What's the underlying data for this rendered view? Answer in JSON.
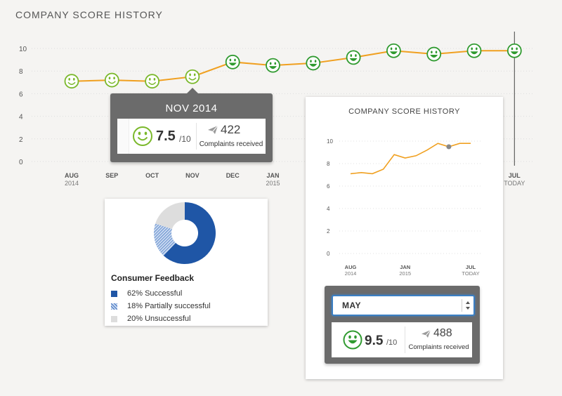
{
  "header": {
    "title": "COMPANY SCORE HISTORY"
  },
  "chart_data": [
    {
      "type": "line",
      "title": "COMPANY SCORE HISTORY",
      "ylim": [
        0,
        10
      ],
      "yticks": [
        0,
        2,
        4,
        6,
        8,
        10
      ],
      "x_labels": [
        {
          "month": "AUG",
          "sub": "2014"
        },
        {
          "month": "SEP",
          "sub": ""
        },
        {
          "month": "OCT",
          "sub": ""
        },
        {
          "month": "NOV",
          "sub": ""
        },
        {
          "month": "DEC",
          "sub": ""
        },
        {
          "month": "JAN",
          "sub": "2015"
        },
        {
          "month": "",
          "sub": ""
        },
        {
          "month": "",
          "sub": ""
        },
        {
          "month": "",
          "sub": ""
        },
        {
          "month": "",
          "sub": ""
        },
        {
          "month": "",
          "sub": ""
        },
        {
          "month": "JUL",
          "sub": "TODAY"
        }
      ],
      "values": [
        7.1,
        7.2,
        7.1,
        7.5,
        8.8,
        8.5,
        8.7,
        9.2,
        9.8,
        9.5,
        9.8,
        9.8
      ],
      "line_color": "#f0a020",
      "marker_color": "#2f9a2f",
      "highlight_index": 3,
      "today_index": 11
    },
    {
      "type": "line",
      "title": "COMPANY SCORE HISTORY",
      "ylim": [
        0,
        10
      ],
      "yticks": [
        0,
        2,
        4,
        6,
        8,
        10
      ],
      "x_labels": [
        {
          "month": "AUG",
          "sub": "2014"
        },
        {
          "month": "JAN",
          "sub": "2015"
        },
        {
          "month": "JUL",
          "sub": "TODAY"
        }
      ],
      "values": [
        7.1,
        7.2,
        7.1,
        7.5,
        8.8,
        8.5,
        8.7,
        9.2,
        9.8,
        9.5,
        9.8,
        9.8
      ],
      "line_color": "#f0a020",
      "highlight_index": 9,
      "highlight_color": "#888888"
    },
    {
      "type": "pie",
      "title": "Consumer Feedback",
      "slices": [
        {
          "label": "62% Successful",
          "value": 62,
          "color": "#1f56a6"
        },
        {
          "label": "18% Partially successful",
          "value": 18,
          "color": "#7da3d8"
        },
        {
          "label": "20% Unsuccessful",
          "value": 20,
          "color": "#dddddd"
        }
      ]
    }
  ],
  "tooltip": {
    "month": "NOV 2014",
    "score": "7.5",
    "denominator": "/10",
    "complaints": "422",
    "complaints_label": "Complaints received"
  },
  "panel": {
    "title": "COMPANY SCORE HISTORY",
    "select_value": "MAY",
    "score": "9.5",
    "denominator": "/10",
    "complaints": "488",
    "complaints_label": "Complaints received"
  },
  "feedback": {
    "title": "Consumer Feedback",
    "items": [
      {
        "label": "62% Successful",
        "color": "#1f56a6"
      },
      {
        "label": "18% Partially successful",
        "color": "#7da3d8"
      },
      {
        "label": "20% Unsuccessful",
        "color": "#dddddd"
      }
    ]
  },
  "icons": {
    "smiley": "smiley-icon",
    "complaint": "paper-plane-icon",
    "select": "select-arrows-icon"
  }
}
